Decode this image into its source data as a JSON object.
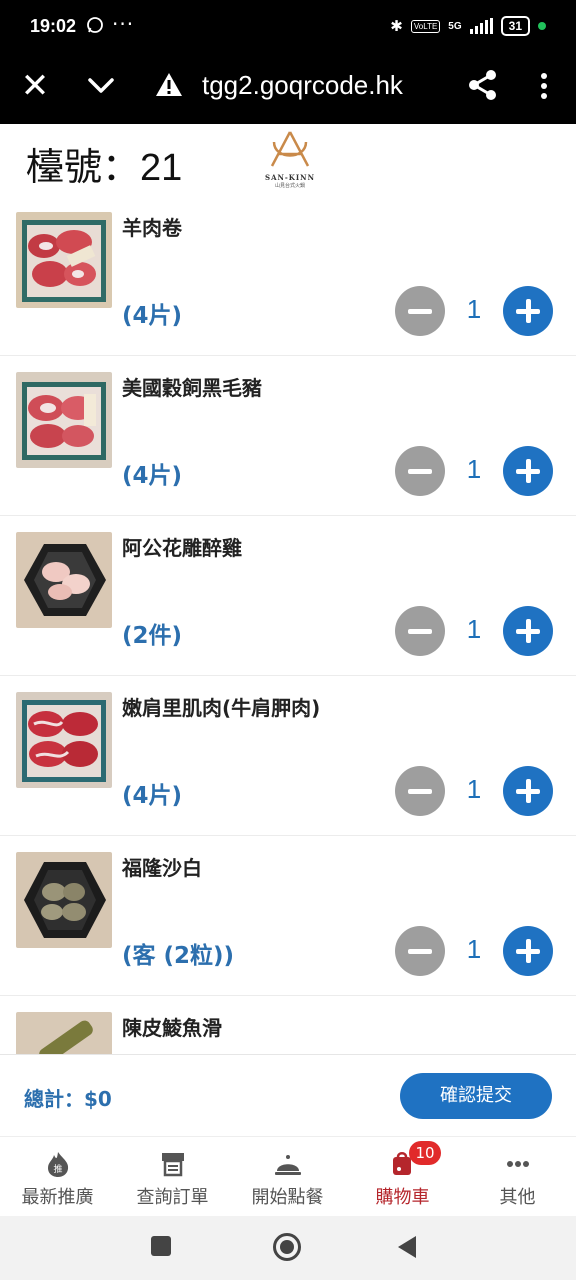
{
  "status_bar": {
    "time": "19:02",
    "network": "5G",
    "volte": "VoLTE",
    "battery": "31"
  },
  "browser": {
    "url": "tgg2.goqrcode.hk"
  },
  "header": {
    "table_label": "檯號：",
    "table_number": "21",
    "logo_brand": "SAN-KINN",
    "logo_sub": "山見台式火鍋"
  },
  "items": [
    {
      "name": "羊肉卷",
      "unit": "(4片)",
      "qty": "1",
      "img": "lamb"
    },
    {
      "name": "美國穀飼黑毛豬",
      "unit": "(4片)",
      "qty": "1",
      "img": "pork"
    },
    {
      "name": "阿公花雕醉雞",
      "unit": "(2件)",
      "qty": "1",
      "img": "chicken"
    },
    {
      "name": "嫩肩里肌肉(牛肩胛肉)",
      "unit": "(4片)",
      "qty": "1",
      "img": "beef"
    },
    {
      "name": "福隆沙白",
      "unit": "(客 (2粒))",
      "qty": "1",
      "img": "clam"
    },
    {
      "name": "陳皮鯪魚滑",
      "unit": "",
      "qty": "",
      "img": "fish"
    }
  ],
  "footer": {
    "total_label": "總計：",
    "total_value": "$0",
    "confirm_label": "確認提交"
  },
  "nav": [
    {
      "label": "最新推廣",
      "icon": "promo-icon"
    },
    {
      "label": "查詢訂單",
      "icon": "orders-icon"
    },
    {
      "label": "開始點餐",
      "icon": "dish-icon"
    },
    {
      "label": "購物車",
      "icon": "cart-icon",
      "badge": "10",
      "active": true
    },
    {
      "label": "其他",
      "icon": "more-icon"
    }
  ],
  "colors": {
    "accent_blue": "#1f72c2",
    "price_blue": "#2c6fae",
    "active_red": "#b5262c",
    "badge_red": "#e12a2a"
  }
}
